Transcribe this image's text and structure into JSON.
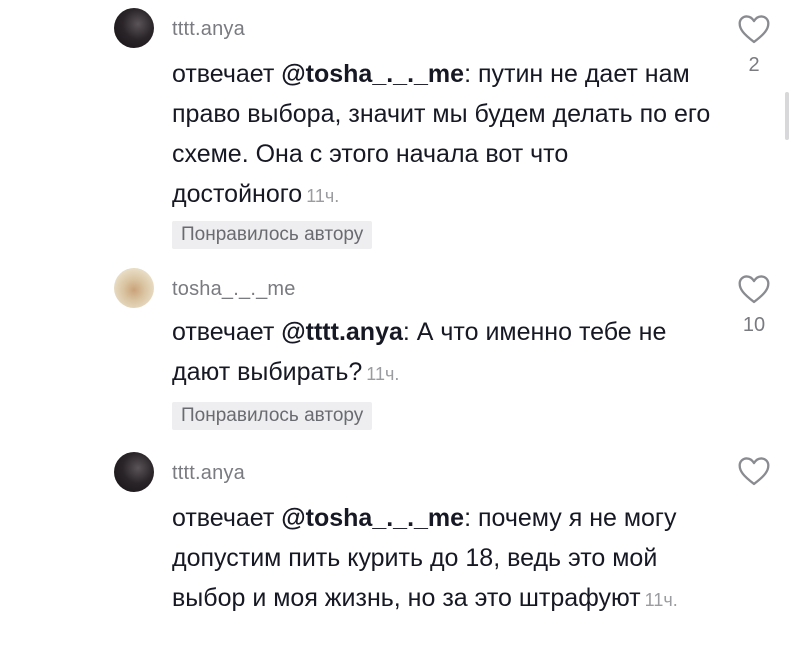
{
  "comments": [
    {
      "username": "tttt.anya",
      "prefix": "отвечает ",
      "mention": "@tosha_._._me",
      "text": ": путин не дает нам право выбора, значит мы будем делать по его схеме. Она с этого начала вот что достойного",
      "time": "11ч.",
      "liked_by_author": "Понравилось автору",
      "like_count": "2"
    },
    {
      "username": "tosha_._._me",
      "prefix": "отвечает ",
      "mention": "@tttt.anya",
      "text": ": А что именно тебе не дают выбирать?",
      "time": "11ч.",
      "liked_by_author": "Понравилось автору",
      "like_count": "10"
    },
    {
      "username": "tttt.anya",
      "prefix": "отвечает ",
      "mention": "@tosha_._._me",
      "text": ": почему я не могу допустим пить курить до 18, ведь это мой выбор и моя жизнь, но за это штрафуют",
      "time": "11ч.",
      "like_count": ""
    }
  ],
  "colors": {
    "text": "#161823",
    "secondary": "#7a7b80",
    "badge_bg": "#eeeef0"
  }
}
